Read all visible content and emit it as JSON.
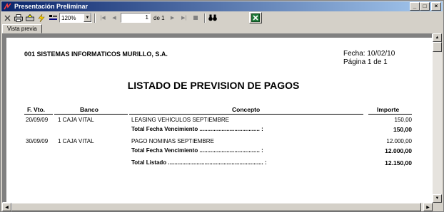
{
  "window": {
    "title": "Presentación Preliminar"
  },
  "toolbar": {
    "zoom": "120%",
    "page": "1",
    "of_pages": "de 1",
    "icons": [
      "close-icon",
      "print-icon",
      "printer-setup-icon",
      "lightning-icon",
      "layout-icon",
      "first-page-icon",
      "prev-page-icon",
      "next-page-icon",
      "last-page-icon",
      "stop-icon",
      "binoculars-icon",
      "excel-icon"
    ]
  },
  "tabs": [
    {
      "label": "Vista previa"
    }
  ],
  "report": {
    "company": "001 SISTEMAS INFORMATICOS MURILLO, S.A.",
    "fecha": "Fecha:  10/02/10",
    "pagina": "Página 1 de 1",
    "title": "LISTADO DE PREVISION DE PAGOS",
    "columns": {
      "fvto": "F. Vto.",
      "banco": "Banco",
      "concepto": "Concepto",
      "importe": "Importe"
    },
    "rows": [
      {
        "fvto": "20/09/09",
        "banco": "1 CAJA VITAL",
        "concepto": "LEASING VEHICULOS SEPTIEMBRE",
        "importe": "150,00",
        "total_label": "Total Fecha Vencimiento ...................................... :",
        "total": "150,00"
      },
      {
        "fvto": "30/09/09",
        "banco": "1 CAJA VITAL",
        "concepto": "PAGO NOMINAS SEPTIEMBRE",
        "importe": "12.000,00",
        "total_label": "Total Fecha Vencimiento ...................................... :",
        "total": "12.000,00"
      }
    ],
    "grand_total_label": "Total Listado ............................................................ :",
    "grand_total": "12.150,00"
  }
}
